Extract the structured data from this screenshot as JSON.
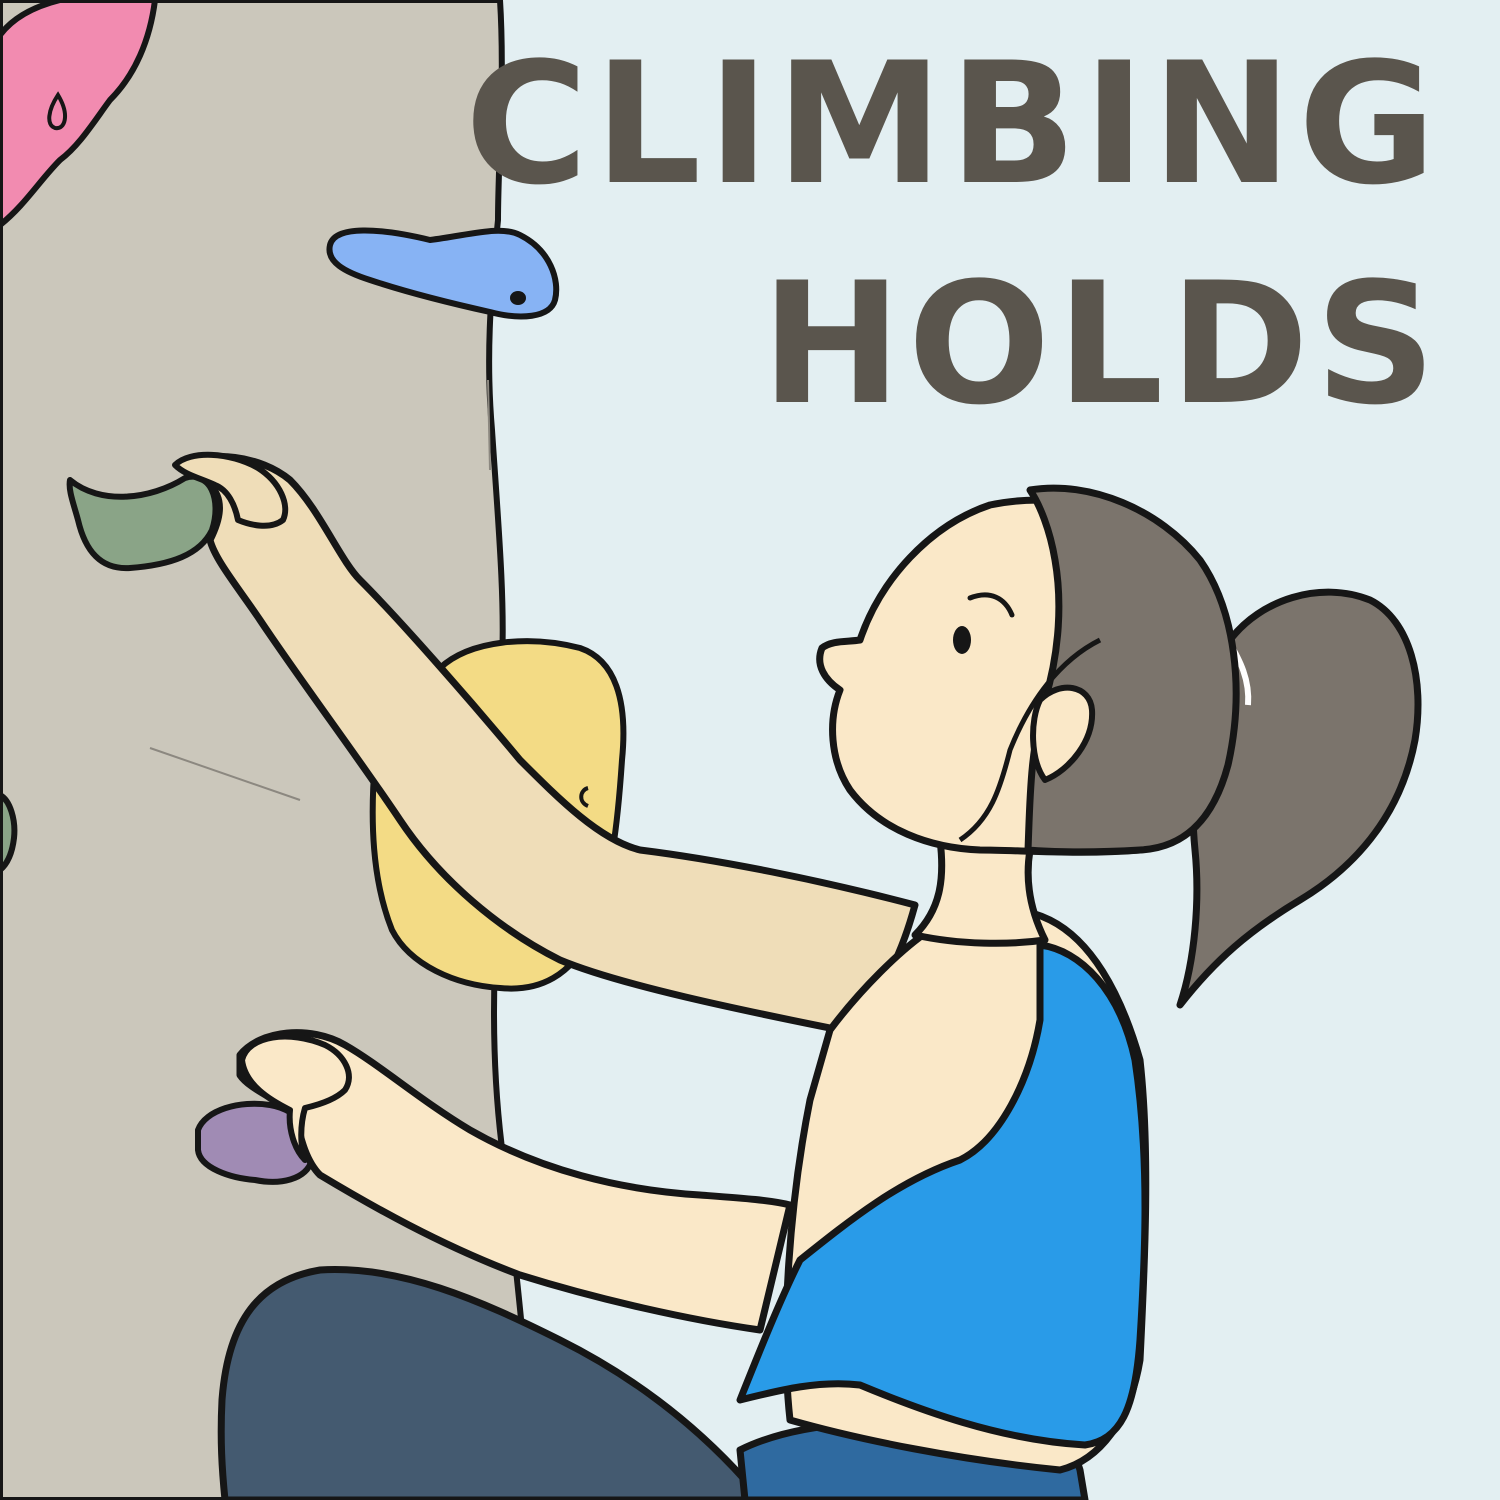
{
  "title": {
    "line1": "CLIMBING",
    "line2": "HOLDS"
  },
  "colors": {
    "background": "#e3eff2",
    "wall": "#cbc7bb",
    "outline": "#161616",
    "title_text": "#5a554d",
    "hold_pink": "#f28bb0",
    "hold_blue": "#87b3f4",
    "hold_green": "#8aa487",
    "hold_yellow": "#f3db85",
    "hold_purple": "#a08bb4",
    "skin": "#fae8c8",
    "skin_shadow": "#efddb8",
    "hair": "#7b746c",
    "tank_top": "#299be8",
    "pants": "#445a70"
  },
  "icons": [
    "climbing-wall-icon",
    "climbing-hold-icon",
    "climber-icon"
  ]
}
